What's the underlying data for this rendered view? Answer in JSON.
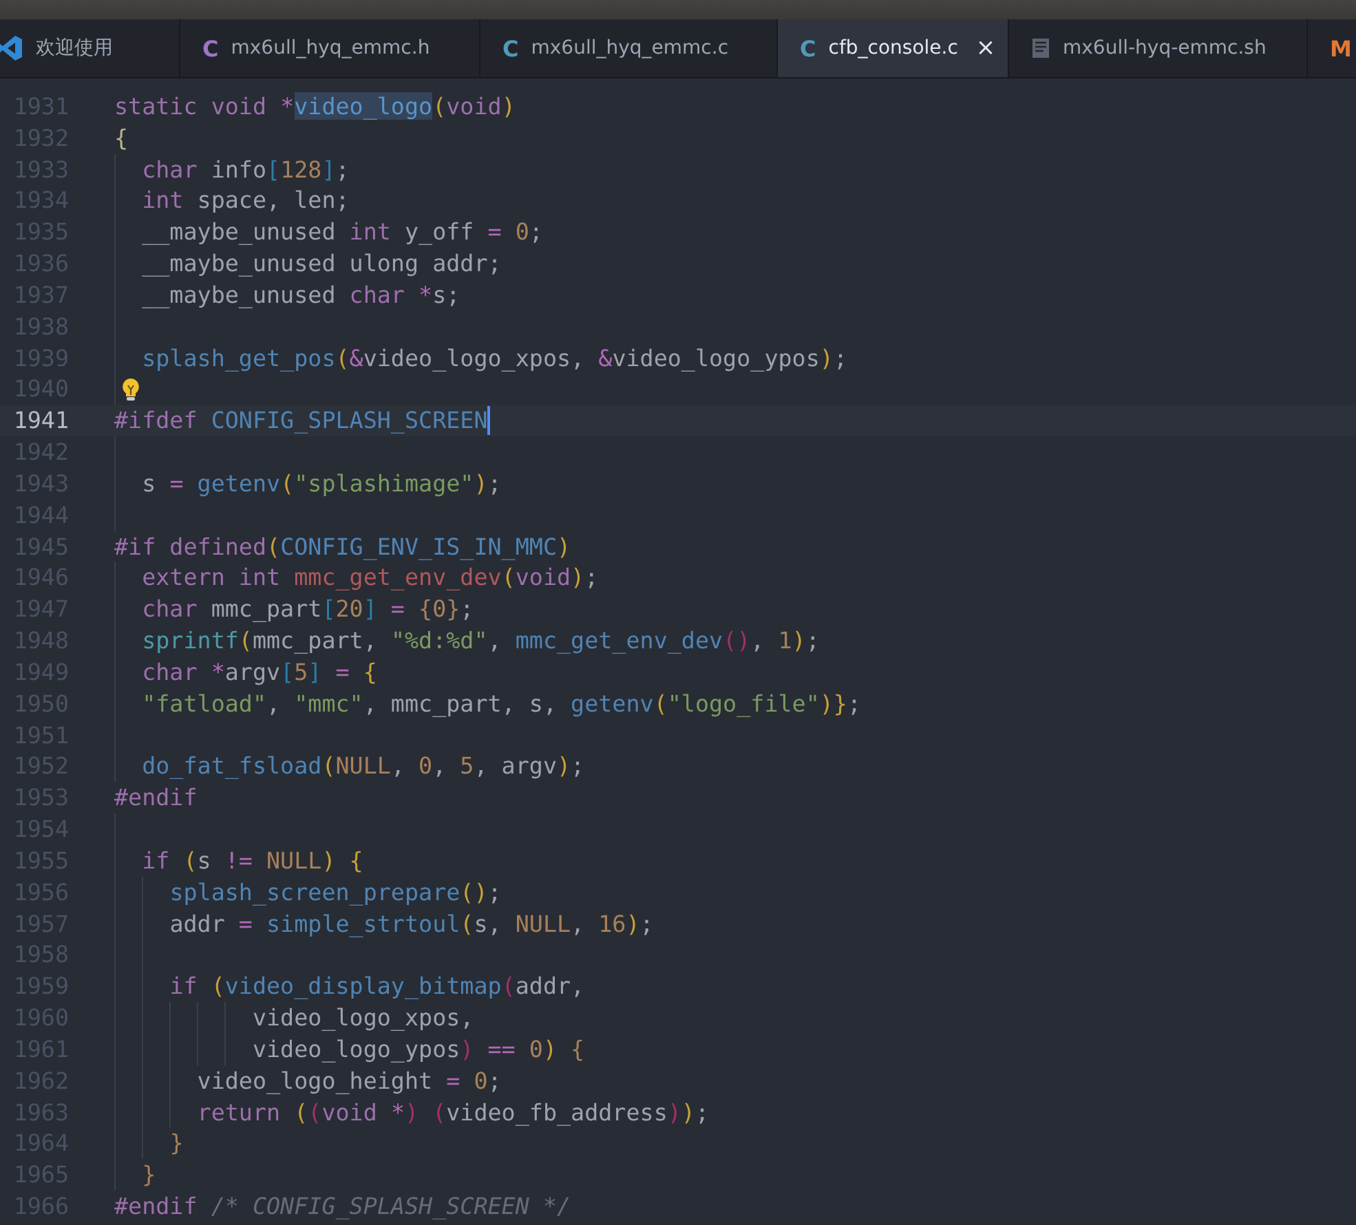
{
  "tabs": [
    {
      "label": "欢迎使用",
      "selected": false,
      "kind": "vscode"
    },
    {
      "label": "mx6ull_hyq_emmc.h",
      "selected": false,
      "kind": "letter",
      "icon_text": "C",
      "color": "#a074c4"
    },
    {
      "label": "mx6ull_hyq_emmc.c",
      "selected": false,
      "kind": "letter",
      "icon_text": "C",
      "color": "#519aba"
    },
    {
      "label": "cfb_console.c",
      "selected": true,
      "kind": "letter",
      "icon_text": "C",
      "color": "#519aba",
      "close": "×"
    },
    {
      "label": "mx6ull-hyq-emmc.sh",
      "selected": false,
      "kind": "document"
    },
    {
      "selected": false,
      "kind": "letter",
      "icon_text": "M",
      "color": "#e37933"
    }
  ],
  "lines": [
    {
      "number": "1931",
      "current": false,
      "tokens": [
        {
          "kind": "kw",
          "text": "static "
        },
        {
          "kind": "kw",
          "text": "void "
        },
        {
          "kind": "op",
          "text": "*"
        },
        {
          "kind": "sel",
          "text": "video_logo"
        },
        {
          "kind": "p1",
          "text": "("
        },
        {
          "kind": "kw",
          "text": "void"
        },
        {
          "kind": "p1",
          "text": ")"
        }
      ]
    },
    {
      "number": "1932",
      "current": false,
      "tokens": [
        {
          "kind": "brace",
          "text": "{"
        }
      ]
    },
    {
      "number": "1933",
      "current": false,
      "tokens": [
        {
          "kind": "kw",
          "text": "  char"
        },
        {
          "kind": "id",
          "text": " info"
        },
        {
          "kind": "br",
          "text": "["
        },
        {
          "kind": "num",
          "text": "128"
        },
        {
          "kind": "br",
          "text": "]"
        },
        {
          "kind": "id",
          "text": ";"
        }
      ]
    },
    {
      "number": "1934",
      "current": false,
      "tokens": [
        {
          "kind": "kw",
          "text": "  int"
        },
        {
          "kind": "id",
          "text": " space, len;"
        }
      ]
    },
    {
      "number": "1935",
      "current": false,
      "tokens": [
        {
          "kind": "id",
          "text": "  __maybe_unused "
        },
        {
          "kind": "kw",
          "text": "int"
        },
        {
          "kind": "id",
          "text": " y_off "
        },
        {
          "kind": "op",
          "text": "= "
        },
        {
          "kind": "num",
          "text": "0"
        },
        {
          "kind": "id",
          "text": ";"
        }
      ]
    },
    {
      "number": "1936",
      "current": false,
      "tokens": [
        {
          "kind": "id",
          "text": "  __maybe_unused ulong addr;"
        }
      ]
    },
    {
      "number": "1937",
      "current": false,
      "tokens": [
        {
          "kind": "id",
          "text": "  __maybe_unused "
        },
        {
          "kind": "kw",
          "text": "char "
        },
        {
          "kind": "op",
          "text": "*"
        },
        {
          "kind": "id",
          "text": "s;"
        }
      ]
    },
    {
      "number": "1938",
      "current": false
    },
    {
      "number": "1939",
      "current": false,
      "tokens": [
        {
          "kind": "fn",
          "text": "  splash_get_pos"
        },
        {
          "kind": "p1",
          "text": "("
        },
        {
          "kind": "op",
          "text": "&"
        },
        {
          "kind": "id",
          "text": "video_logo_xpos, "
        },
        {
          "kind": "op",
          "text": "&"
        },
        {
          "kind": "id",
          "text": "video_logo_ypos"
        },
        {
          "kind": "p1",
          "text": ")"
        },
        {
          "kind": "id",
          "text": ";"
        }
      ]
    },
    {
      "number": "1940",
      "current": false,
      "kind": "lightbulb"
    },
    {
      "number": "1941",
      "current": true,
      "tokens": [
        {
          "kind": "kw",
          "text": "#ifdef "
        },
        {
          "kind": "fn",
          "text": "CONFIG_SPLASH_SCREEN"
        }
      ]
    },
    {
      "number": "1942",
      "current": false
    },
    {
      "number": "1943",
      "current": false,
      "tokens": [
        {
          "kind": "id",
          "text": "  s "
        },
        {
          "kind": "op",
          "text": "= "
        },
        {
          "kind": "fn",
          "text": "getenv"
        },
        {
          "kind": "p1",
          "text": "("
        },
        {
          "kind": "str",
          "text": "\"splashimage\""
        },
        {
          "kind": "p1",
          "text": ")"
        },
        {
          "kind": "id",
          "text": ";"
        }
      ]
    },
    {
      "number": "1944",
      "current": false
    },
    {
      "number": "1945",
      "current": false,
      "tokens": [
        {
          "kind": "kw",
          "text": "#if defined"
        },
        {
          "kind": "p1",
          "text": "("
        },
        {
          "kind": "fn",
          "text": "CONFIG_ENV_IS_IN_MMC"
        },
        {
          "kind": "p1",
          "text": ")"
        }
      ]
    },
    {
      "number": "1946",
      "current": false,
      "tokens": [
        {
          "kind": "kw",
          "text": "  extern int "
        },
        {
          "kind": "efn",
          "text": "mmc_get_env_dev"
        },
        {
          "kind": "p1",
          "text": "("
        },
        {
          "kind": "kw",
          "text": "void"
        },
        {
          "kind": "p1",
          "text": ")"
        },
        {
          "kind": "id",
          "text": ";"
        }
      ]
    },
    {
      "number": "1947",
      "current": false,
      "tokens": [
        {
          "kind": "kw",
          "text": "  char"
        },
        {
          "kind": "id",
          "text": " mmc_part"
        },
        {
          "kind": "br",
          "text": "["
        },
        {
          "kind": "num",
          "text": "20"
        },
        {
          "kind": "br",
          "text": "]"
        },
        {
          "kind": "op",
          "text": " = "
        },
        {
          "kind": "num",
          "text": "{0}"
        },
        {
          "kind": "id",
          "text": ";"
        }
      ]
    },
    {
      "number": "1948",
      "current": false,
      "tokens": [
        {
          "kind": "fn2",
          "text": "  sprintf"
        },
        {
          "kind": "p1",
          "text": "("
        },
        {
          "kind": "id",
          "text": "mmc_part, "
        },
        {
          "kind": "str",
          "text": "\"%d:%d\""
        },
        {
          "kind": "id",
          "text": ", "
        },
        {
          "kind": "fn",
          "text": "mmc_get_env_dev"
        },
        {
          "kind": "p2",
          "text": "()"
        },
        {
          "kind": "id",
          "text": ", "
        },
        {
          "kind": "num",
          "text": "1"
        },
        {
          "kind": "p1",
          "text": ")"
        },
        {
          "kind": "id",
          "text": ";"
        }
      ]
    },
    {
      "number": "1949",
      "current": false,
      "tokens": [
        {
          "kind": "kw",
          "text": "  char "
        },
        {
          "kind": "op",
          "text": "*"
        },
        {
          "kind": "id",
          "text": "argv"
        },
        {
          "kind": "br",
          "text": "["
        },
        {
          "kind": "num",
          "text": "5"
        },
        {
          "kind": "br",
          "text": "]"
        },
        {
          "kind": "op",
          "text": " = "
        },
        {
          "kind": "p1",
          "text": "{"
        }
      ]
    },
    {
      "number": "1950",
      "current": false,
      "tokens": [
        {
          "kind": "str",
          "text": "  \"fatload\""
        },
        {
          "kind": "id",
          "text": ", "
        },
        {
          "kind": "str",
          "text": "\"mmc\""
        },
        {
          "kind": "id",
          "text": ", mmc_part, s, "
        },
        {
          "kind": "fn",
          "text": "getenv"
        },
        {
          "kind": "p1",
          "text": "("
        },
        {
          "kind": "str",
          "text": "\"logo_file\""
        },
        {
          "kind": "p1",
          "text": ")}"
        },
        {
          "kind": "id",
          "text": ";"
        }
      ]
    },
    {
      "number": "1951",
      "current": false
    },
    {
      "number": "1952",
      "current": false,
      "tokens": [
        {
          "kind": "fn",
          "text": "  do_fat_fsload"
        },
        {
          "kind": "p1",
          "text": "("
        },
        {
          "kind": "num",
          "text": "NULL"
        },
        {
          "kind": "id",
          "text": ", "
        },
        {
          "kind": "num",
          "text": "0"
        },
        {
          "kind": "id",
          "text": ", "
        },
        {
          "kind": "num",
          "text": "5"
        },
        {
          "kind": "id",
          "text": ", argv"
        },
        {
          "kind": "p1",
          "text": ")"
        },
        {
          "kind": "id",
          "text": ";"
        }
      ]
    },
    {
      "number": "1953",
      "current": false,
      "tokens": [
        {
          "kind": "kw",
          "text": "#endif"
        }
      ]
    },
    {
      "number": "1954",
      "current": false
    },
    {
      "number": "1955",
      "current": false,
      "tokens": [
        {
          "kind": "kw",
          "text": "  if "
        },
        {
          "kind": "p1",
          "text": "("
        },
        {
          "kind": "id",
          "text": "s "
        },
        {
          "kind": "op",
          "text": "!= "
        },
        {
          "kind": "num",
          "text": "NULL"
        },
        {
          "kind": "p1",
          "text": ") {"
        }
      ]
    },
    {
      "number": "1956",
      "current": false,
      "tokens": [
        {
          "kind": "fn",
          "text": "    splash_screen_prepare"
        },
        {
          "kind": "p1",
          "text": "()"
        },
        {
          "kind": "id",
          "text": ";"
        }
      ]
    },
    {
      "number": "1957",
      "current": false,
      "tokens": [
        {
          "kind": "id",
          "text": "    addr "
        },
        {
          "kind": "op",
          "text": "= "
        },
        {
          "kind": "fn",
          "text": "simple_strtoul"
        },
        {
          "kind": "p1",
          "text": "("
        },
        {
          "kind": "id",
          "text": "s, "
        },
        {
          "kind": "num",
          "text": "NULL"
        },
        {
          "kind": "id",
          "text": ", "
        },
        {
          "kind": "num",
          "text": "16"
        },
        {
          "kind": "p1",
          "text": ")"
        },
        {
          "kind": "id",
          "text": ";"
        }
      ]
    },
    {
      "number": "1958",
      "current": false
    },
    {
      "number": "1959",
      "current": false,
      "tokens": [
        {
          "kind": "kw",
          "text": "    if "
        },
        {
          "kind": "p1",
          "text": "("
        },
        {
          "kind": "fn",
          "text": "video_display_bitmap"
        },
        {
          "kind": "p2",
          "text": "("
        },
        {
          "kind": "id",
          "text": "addr,"
        }
      ]
    },
    {
      "number": "1960",
      "current": false,
      "tokens": [
        {
          "kind": "id",
          "text": "          video_logo_xpos,"
        }
      ]
    },
    {
      "number": "1961",
      "current": false,
      "tokens": [
        {
          "kind": "id",
          "text": "          video_logo_ypos"
        },
        {
          "kind": "p2",
          "text": ")"
        },
        {
          "kind": "op",
          "text": " == "
        },
        {
          "kind": "num",
          "text": "0"
        },
        {
          "kind": "p1",
          "text": ")"
        },
        {
          "kind": "num",
          "text": " {"
        }
      ]
    },
    {
      "number": "1962",
      "current": false,
      "tokens": [
        {
          "kind": "id",
          "text": "      video_logo_height "
        },
        {
          "kind": "op",
          "text": "= "
        },
        {
          "kind": "num",
          "text": "0"
        },
        {
          "kind": "id",
          "text": ";"
        }
      ]
    },
    {
      "number": "1963",
      "current": false,
      "tokens": [
        {
          "kind": "kw",
          "text": "      return "
        },
        {
          "kind": "p1",
          "text": "("
        },
        {
          "kind": "p2",
          "text": "("
        },
        {
          "kind": "kw",
          "text": "void "
        },
        {
          "kind": "op",
          "text": "*"
        },
        {
          "kind": "p2",
          "text": ") ("
        },
        {
          "kind": "id",
          "text": "video_fb_address"
        },
        {
          "kind": "p2",
          "text": ")"
        },
        {
          "kind": "p1",
          "text": ")"
        },
        {
          "kind": "id",
          "text": ";"
        }
      ]
    },
    {
      "number": "1964",
      "current": false,
      "tokens": [
        {
          "kind": "num",
          "text": "    }"
        }
      ]
    },
    {
      "number": "1965",
      "current": false,
      "tokens": [
        {
          "kind": "num",
          "text": "  }"
        }
      ]
    },
    {
      "number": "1966",
      "current": false,
      "tokens": [
        {
          "kind": "kw",
          "text": "#endif "
        },
        {
          "kind": "cm",
          "text": "/* CONFIG_SPLASH_SCREEN */"
        }
      ]
    }
  ]
}
